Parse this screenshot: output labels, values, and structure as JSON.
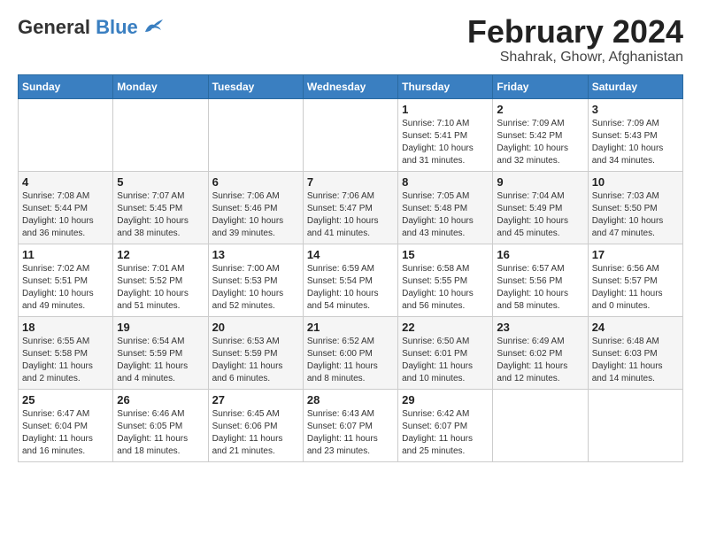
{
  "header": {
    "logo_general": "General",
    "logo_blue": "Blue",
    "title": "February 2024",
    "subtitle": "Shahrak, Ghowr, Afghanistan"
  },
  "weekdays": [
    "Sunday",
    "Monday",
    "Tuesday",
    "Wednesday",
    "Thursday",
    "Friday",
    "Saturday"
  ],
  "weeks": [
    [
      {
        "day": "",
        "sunrise": "",
        "sunset": "",
        "daylight": ""
      },
      {
        "day": "",
        "sunrise": "",
        "sunset": "",
        "daylight": ""
      },
      {
        "day": "",
        "sunrise": "",
        "sunset": "",
        "daylight": ""
      },
      {
        "day": "",
        "sunrise": "",
        "sunset": "",
        "daylight": ""
      },
      {
        "day": "1",
        "sunrise": "Sunrise: 7:10 AM",
        "sunset": "Sunset: 5:41 PM",
        "daylight": "Daylight: 10 hours and 31 minutes."
      },
      {
        "day": "2",
        "sunrise": "Sunrise: 7:09 AM",
        "sunset": "Sunset: 5:42 PM",
        "daylight": "Daylight: 10 hours and 32 minutes."
      },
      {
        "day": "3",
        "sunrise": "Sunrise: 7:09 AM",
        "sunset": "Sunset: 5:43 PM",
        "daylight": "Daylight: 10 hours and 34 minutes."
      }
    ],
    [
      {
        "day": "4",
        "sunrise": "Sunrise: 7:08 AM",
        "sunset": "Sunset: 5:44 PM",
        "daylight": "Daylight: 10 hours and 36 minutes."
      },
      {
        "day": "5",
        "sunrise": "Sunrise: 7:07 AM",
        "sunset": "Sunset: 5:45 PM",
        "daylight": "Daylight: 10 hours and 38 minutes."
      },
      {
        "day": "6",
        "sunrise": "Sunrise: 7:06 AM",
        "sunset": "Sunset: 5:46 PM",
        "daylight": "Daylight: 10 hours and 39 minutes."
      },
      {
        "day": "7",
        "sunrise": "Sunrise: 7:06 AM",
        "sunset": "Sunset: 5:47 PM",
        "daylight": "Daylight: 10 hours and 41 minutes."
      },
      {
        "day": "8",
        "sunrise": "Sunrise: 7:05 AM",
        "sunset": "Sunset: 5:48 PM",
        "daylight": "Daylight: 10 hours and 43 minutes."
      },
      {
        "day": "9",
        "sunrise": "Sunrise: 7:04 AM",
        "sunset": "Sunset: 5:49 PM",
        "daylight": "Daylight: 10 hours and 45 minutes."
      },
      {
        "day": "10",
        "sunrise": "Sunrise: 7:03 AM",
        "sunset": "Sunset: 5:50 PM",
        "daylight": "Daylight: 10 hours and 47 minutes."
      }
    ],
    [
      {
        "day": "11",
        "sunrise": "Sunrise: 7:02 AM",
        "sunset": "Sunset: 5:51 PM",
        "daylight": "Daylight: 10 hours and 49 minutes."
      },
      {
        "day": "12",
        "sunrise": "Sunrise: 7:01 AM",
        "sunset": "Sunset: 5:52 PM",
        "daylight": "Daylight: 10 hours and 51 minutes."
      },
      {
        "day": "13",
        "sunrise": "Sunrise: 7:00 AM",
        "sunset": "Sunset: 5:53 PM",
        "daylight": "Daylight: 10 hours and 52 minutes."
      },
      {
        "day": "14",
        "sunrise": "Sunrise: 6:59 AM",
        "sunset": "Sunset: 5:54 PM",
        "daylight": "Daylight: 10 hours and 54 minutes."
      },
      {
        "day": "15",
        "sunrise": "Sunrise: 6:58 AM",
        "sunset": "Sunset: 5:55 PM",
        "daylight": "Daylight: 10 hours and 56 minutes."
      },
      {
        "day": "16",
        "sunrise": "Sunrise: 6:57 AM",
        "sunset": "Sunset: 5:56 PM",
        "daylight": "Daylight: 10 hours and 58 minutes."
      },
      {
        "day": "17",
        "sunrise": "Sunrise: 6:56 AM",
        "sunset": "Sunset: 5:57 PM",
        "daylight": "Daylight: 11 hours and 0 minutes."
      }
    ],
    [
      {
        "day": "18",
        "sunrise": "Sunrise: 6:55 AM",
        "sunset": "Sunset: 5:58 PM",
        "daylight": "Daylight: 11 hours and 2 minutes."
      },
      {
        "day": "19",
        "sunrise": "Sunrise: 6:54 AM",
        "sunset": "Sunset: 5:59 PM",
        "daylight": "Daylight: 11 hours and 4 minutes."
      },
      {
        "day": "20",
        "sunrise": "Sunrise: 6:53 AM",
        "sunset": "Sunset: 5:59 PM",
        "daylight": "Daylight: 11 hours and 6 minutes."
      },
      {
        "day": "21",
        "sunrise": "Sunrise: 6:52 AM",
        "sunset": "Sunset: 6:00 PM",
        "daylight": "Daylight: 11 hours and 8 minutes."
      },
      {
        "day": "22",
        "sunrise": "Sunrise: 6:50 AM",
        "sunset": "Sunset: 6:01 PM",
        "daylight": "Daylight: 11 hours and 10 minutes."
      },
      {
        "day": "23",
        "sunrise": "Sunrise: 6:49 AM",
        "sunset": "Sunset: 6:02 PM",
        "daylight": "Daylight: 11 hours and 12 minutes."
      },
      {
        "day": "24",
        "sunrise": "Sunrise: 6:48 AM",
        "sunset": "Sunset: 6:03 PM",
        "daylight": "Daylight: 11 hours and 14 minutes."
      }
    ],
    [
      {
        "day": "25",
        "sunrise": "Sunrise: 6:47 AM",
        "sunset": "Sunset: 6:04 PM",
        "daylight": "Daylight: 11 hours and 16 minutes."
      },
      {
        "day": "26",
        "sunrise": "Sunrise: 6:46 AM",
        "sunset": "Sunset: 6:05 PM",
        "daylight": "Daylight: 11 hours and 18 minutes."
      },
      {
        "day": "27",
        "sunrise": "Sunrise: 6:45 AM",
        "sunset": "Sunset: 6:06 PM",
        "daylight": "Daylight: 11 hours and 21 minutes."
      },
      {
        "day": "28",
        "sunrise": "Sunrise: 6:43 AM",
        "sunset": "Sunset: 6:07 PM",
        "daylight": "Daylight: 11 hours and 23 minutes."
      },
      {
        "day": "29",
        "sunrise": "Sunrise: 6:42 AM",
        "sunset": "Sunset: 6:07 PM",
        "daylight": "Daylight: 11 hours and 25 minutes."
      },
      {
        "day": "",
        "sunrise": "",
        "sunset": "",
        "daylight": ""
      },
      {
        "day": "",
        "sunrise": "",
        "sunset": "",
        "daylight": ""
      }
    ]
  ]
}
